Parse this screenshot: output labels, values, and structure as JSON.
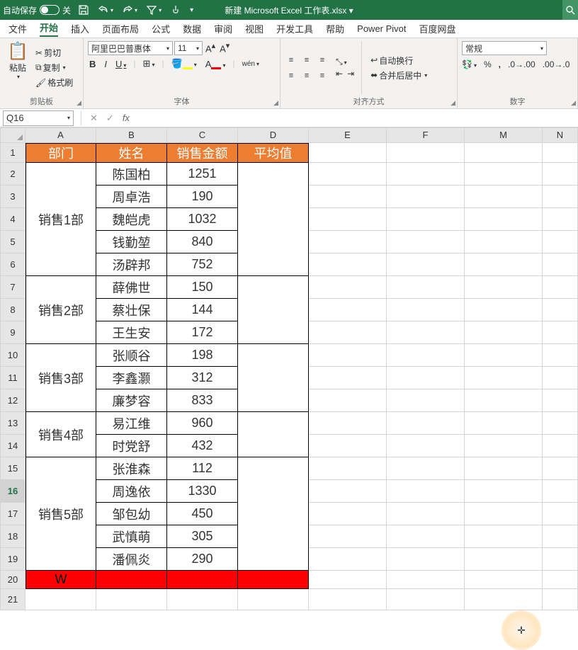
{
  "title": "新建 Microsoft Excel 工作表.xlsx ▾",
  "autosave": {
    "label": "自动保存",
    "state": "关"
  },
  "tabs": {
    "file": "文件",
    "home": "开始",
    "insert": "插入",
    "pagelayout": "页面布局",
    "formulas": "公式",
    "data": "数据",
    "review": "审阅",
    "view": "视图",
    "developer": "开发工具",
    "help": "帮助",
    "powerpivot": "Power Pivot",
    "baidu": "百度网盘"
  },
  "ribbon": {
    "clipboard": {
      "paste": "粘贴",
      "cut": "剪切",
      "copy": "复制",
      "formatpainter": "格式刷",
      "group": "剪贴板"
    },
    "font": {
      "name": "阿里巴巴普惠体",
      "size": "11",
      "group": "字体",
      "wen": "wén"
    },
    "align": {
      "wrap": "自动换行",
      "merge": "合并后居中",
      "group": "对齐方式"
    },
    "number": {
      "format": "常规",
      "group": "数字"
    }
  },
  "namebox": "Q16",
  "formula": "",
  "columns": [
    "A",
    "B",
    "C",
    "D",
    "E",
    "F",
    "M",
    "N"
  ],
  "header_row": {
    "A": "部门",
    "B": "姓名",
    "C": "销售金额",
    "D": "平均值"
  },
  "departments": [
    {
      "name": "销售1部",
      "start": 2,
      "span": 5
    },
    {
      "name": "销售2部",
      "start": 7,
      "span": 3
    },
    {
      "name": "销售3部",
      "start": 10,
      "span": 3
    },
    {
      "name": "销售4部",
      "start": 13,
      "span": 2
    },
    {
      "name": "销售5部",
      "start": 15,
      "span": 5
    }
  ],
  "rows": [
    {
      "n": 2,
      "B": "陈国柏",
      "C": "1251"
    },
    {
      "n": 3,
      "B": "周卓浩",
      "C": "190"
    },
    {
      "n": 4,
      "B": "魏皑虎",
      "C": "1032"
    },
    {
      "n": 5,
      "B": "钱勤堃",
      "C": "840"
    },
    {
      "n": 6,
      "B": "汤辟邦",
      "C": "752"
    },
    {
      "n": 7,
      "B": "薛佛世",
      "C": "150"
    },
    {
      "n": 8,
      "B": "蔡壮保",
      "C": "144"
    },
    {
      "n": 9,
      "B": "王生安",
      "C": "172"
    },
    {
      "n": 10,
      "B": "张顺谷",
      "C": "198"
    },
    {
      "n": 11,
      "B": "李鑫灏",
      "C": "312"
    },
    {
      "n": 12,
      "B": "廉梦容",
      "C": "833"
    },
    {
      "n": 13,
      "B": "易江维",
      "C": "960"
    },
    {
      "n": 14,
      "B": "时党舒",
      "C": "432"
    },
    {
      "n": 15,
      "B": "张淮森",
      "C": "112"
    },
    {
      "n": 16,
      "B": "周逸依",
      "C": "1330"
    },
    {
      "n": 17,
      "B": "邹包幼",
      "C": "450"
    },
    {
      "n": 18,
      "B": "武慎萌",
      "C": "305"
    },
    {
      "n": 19,
      "B": "潘佩炎",
      "C": "290"
    }
  ],
  "row20": {
    "A": "W"
  },
  "selected_row": 16
}
